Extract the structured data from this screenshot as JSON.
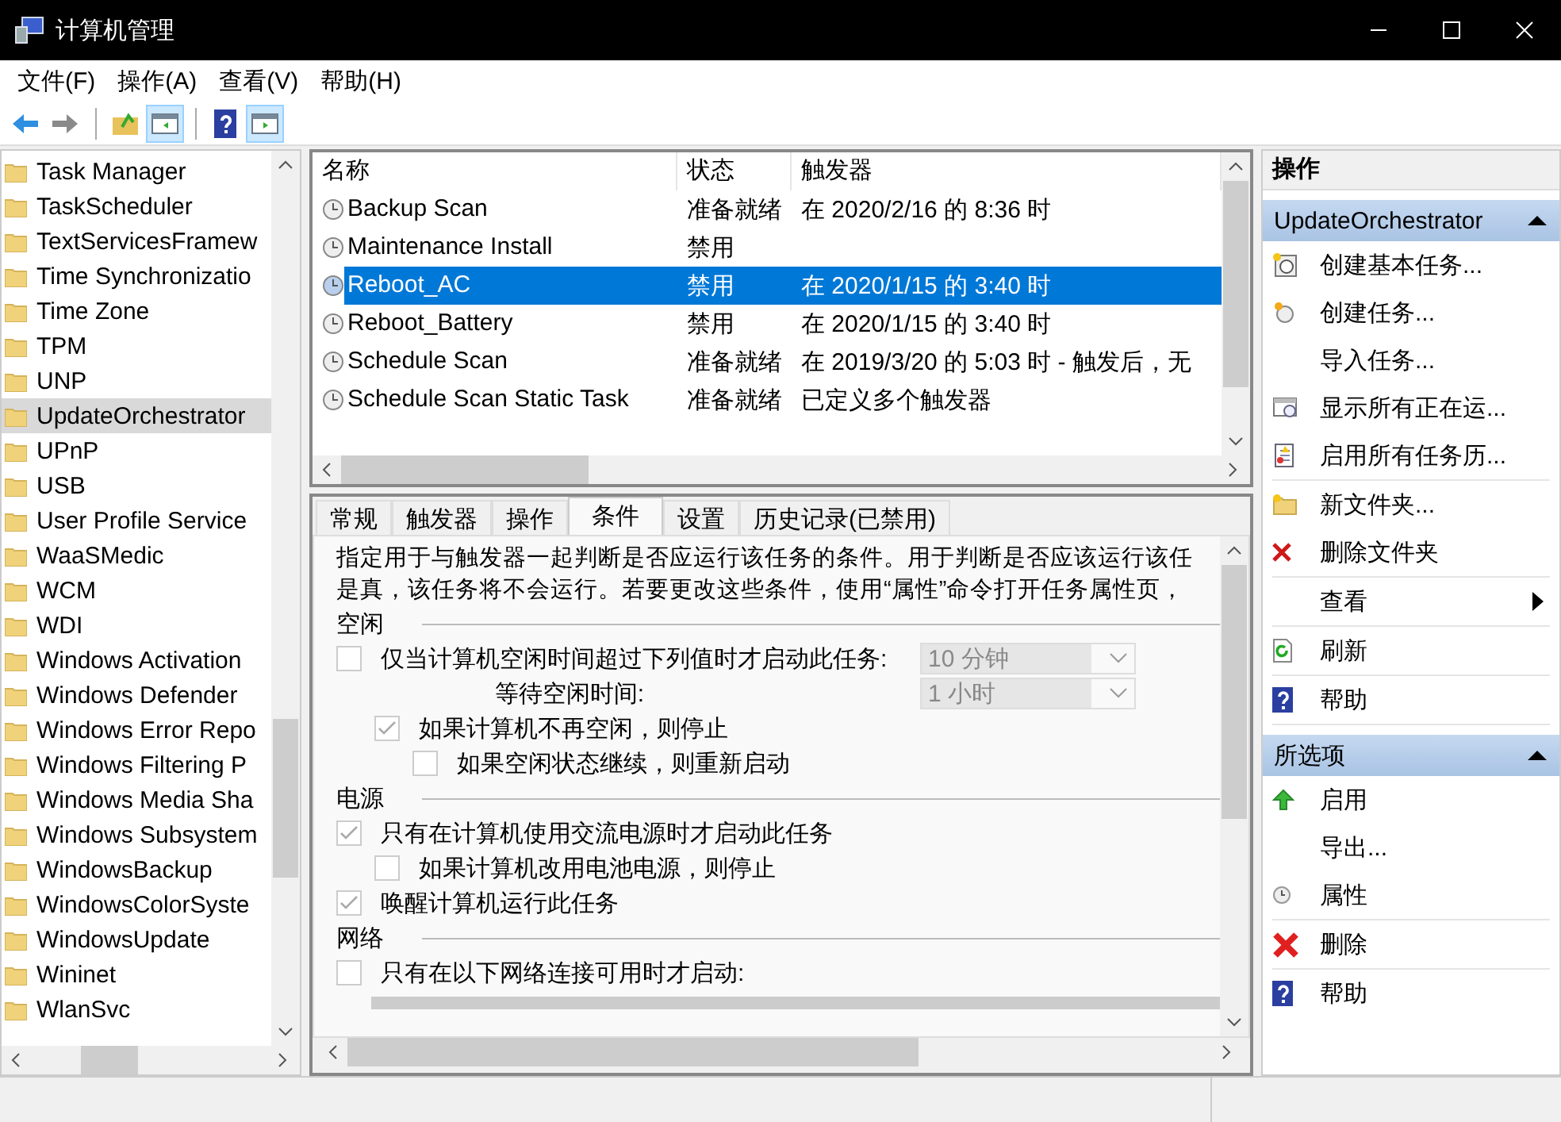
{
  "window": {
    "title": "计算机管理"
  },
  "menu": [
    "文件(F)",
    "操作(A)",
    "查看(V)",
    "帮助(H)"
  ],
  "toolbar": [
    {
      "kind": "back",
      "pressed": false
    },
    {
      "kind": "forward",
      "pressed": false
    },
    {
      "kind": "up",
      "pressed": false
    },
    {
      "kind": "tree",
      "pressed": true
    },
    {
      "kind": "help",
      "pressed": false
    },
    {
      "kind": "pane",
      "pressed": true
    }
  ],
  "tree": [
    {
      "label": "Task Manager",
      "selected": false
    },
    {
      "label": "TaskScheduler",
      "selected": false
    },
    {
      "label": "TextServicesFramew",
      "selected": false
    },
    {
      "label": "Time Synchronizatio",
      "selected": false
    },
    {
      "label": "Time Zone",
      "selected": false
    },
    {
      "label": "TPM",
      "selected": false
    },
    {
      "label": "UNP",
      "selected": false
    },
    {
      "label": "UpdateOrchestrator",
      "selected": true
    },
    {
      "label": "UPnP",
      "selected": false
    },
    {
      "label": "USB",
      "selected": false
    },
    {
      "label": "User Profile Service",
      "selected": false
    },
    {
      "label": "WaaSMedic",
      "selected": false
    },
    {
      "label": "WCM",
      "selected": false
    },
    {
      "label": "WDI",
      "selected": false
    },
    {
      "label": "Windows Activation",
      "selected": false
    },
    {
      "label": "Windows Defender",
      "selected": false
    },
    {
      "label": "Windows Error Repo",
      "selected": false
    },
    {
      "label": "Windows Filtering P",
      "selected": false
    },
    {
      "label": "Windows Media Sha",
      "selected": false
    },
    {
      "label": "Windows Subsystem",
      "selected": false
    },
    {
      "label": "WindowsBackup",
      "selected": false
    },
    {
      "label": "WindowsColorSyste",
      "selected": false
    },
    {
      "label": "WindowsUpdate",
      "selected": false
    },
    {
      "label": "Wininet",
      "selected": false
    },
    {
      "label": "WlanSvc",
      "selected": false
    }
  ],
  "tasks": {
    "columns": [
      "名称",
      "状态",
      "触发器"
    ],
    "rows": [
      {
        "name": "Backup Scan",
        "status": "准备就绪",
        "trigger": "在 2020/2/16 的 8:36 时",
        "selected": false
      },
      {
        "name": "Maintenance Install",
        "status": "禁用",
        "trigger": "",
        "selected": false
      },
      {
        "name": "Reboot_AC",
        "status": "禁用",
        "trigger": "在 2020/1/15 的 3:40 时",
        "selected": true
      },
      {
        "name": "Reboot_Battery",
        "status": "禁用",
        "trigger": "在 2020/1/15 的 3:40 时",
        "selected": false
      },
      {
        "name": "Schedule Scan",
        "status": "准备就绪",
        "trigger": "在 2019/3/20 的 5:03 时 - 触发后，无",
        "selected": false
      },
      {
        "name": "Schedule Scan Static Task",
        "status": "准备就绪",
        "trigger": "已定义多个触发器",
        "selected": false
      }
    ]
  },
  "tabs": [
    {
      "label": "常规",
      "selected": false
    },
    {
      "label": "触发器",
      "selected": false
    },
    {
      "label": "操作",
      "selected": false
    },
    {
      "label": "条件",
      "selected": true
    },
    {
      "label": "设置",
      "selected": false
    },
    {
      "label": "历史记录(已禁用)",
      "selected": false
    }
  ],
  "description": [
    "指定用于与触发器一起判断是否应运行该任务的条件。用于判断是否应该运行该任",
    "是真，该任务将不会运行。若要更改这些条件，使用“属性”命令打开任务属性页，"
  ],
  "conditions": [
    {
      "kind": "section",
      "label": "空闲"
    },
    {
      "kind": "checkbox",
      "label": "仅当计算机空闲时间超过下列值时才启动此任务:",
      "checked": false,
      "value": "10 分钟",
      "children": [
        {
          "kind": "field",
          "label": "等待空闲时间:",
          "value": "1 小时"
        },
        {
          "kind": "checkbox",
          "label": "如果计算机不再空闲，则停止",
          "checked": true,
          "children": [
            {
              "kind": "checkbox",
              "label": "如果空闲状态继续，则重新启动",
              "checked": false
            }
          ]
        }
      ]
    },
    {
      "kind": "section",
      "label": "电源"
    },
    {
      "kind": "checkbox",
      "label": "只有在计算机使用交流电源时才启动此任务",
      "checked": true,
      "children": [
        {
          "kind": "checkbox",
          "label": "如果计算机改用电池电源，则停止",
          "checked": false
        }
      ]
    },
    {
      "kind": "checkbox",
      "label": "唤醒计算机运行此任务",
      "checked": true
    },
    {
      "kind": "section",
      "label": "网络"
    },
    {
      "kind": "checkbox",
      "label": "只有在以下网络连接可用时才启动:",
      "checked": false
    }
  ],
  "actions": {
    "title": "操作",
    "sections": [
      {
        "title": "UpdateOrchestrator",
        "groups": [
          [
            {
              "label": "创建基本任务..."
            },
            {
              "label": "创建任务..."
            },
            {
              "label": "导入任务..."
            },
            {
              "label": "显示所有正在运..."
            },
            {
              "label": "启用所有任务历..."
            }
          ],
          [
            {
              "label": "新文件夹..."
            },
            {
              "label": "删除文件夹"
            }
          ],
          [
            {
              "label": "查看",
              "submenu": true
            }
          ],
          [
            {
              "label": "刷新"
            }
          ],
          [
            {
              "label": "帮助"
            }
          ]
        ]
      },
      {
        "title": "所选项",
        "groups": [
          [
            {
              "label": "启用"
            },
            {
              "label": "导出..."
            },
            {
              "label": "属性"
            }
          ],
          [
            {
              "label": "删除"
            }
          ],
          [
            {
              "label": "帮助"
            }
          ]
        ]
      }
    ]
  }
}
